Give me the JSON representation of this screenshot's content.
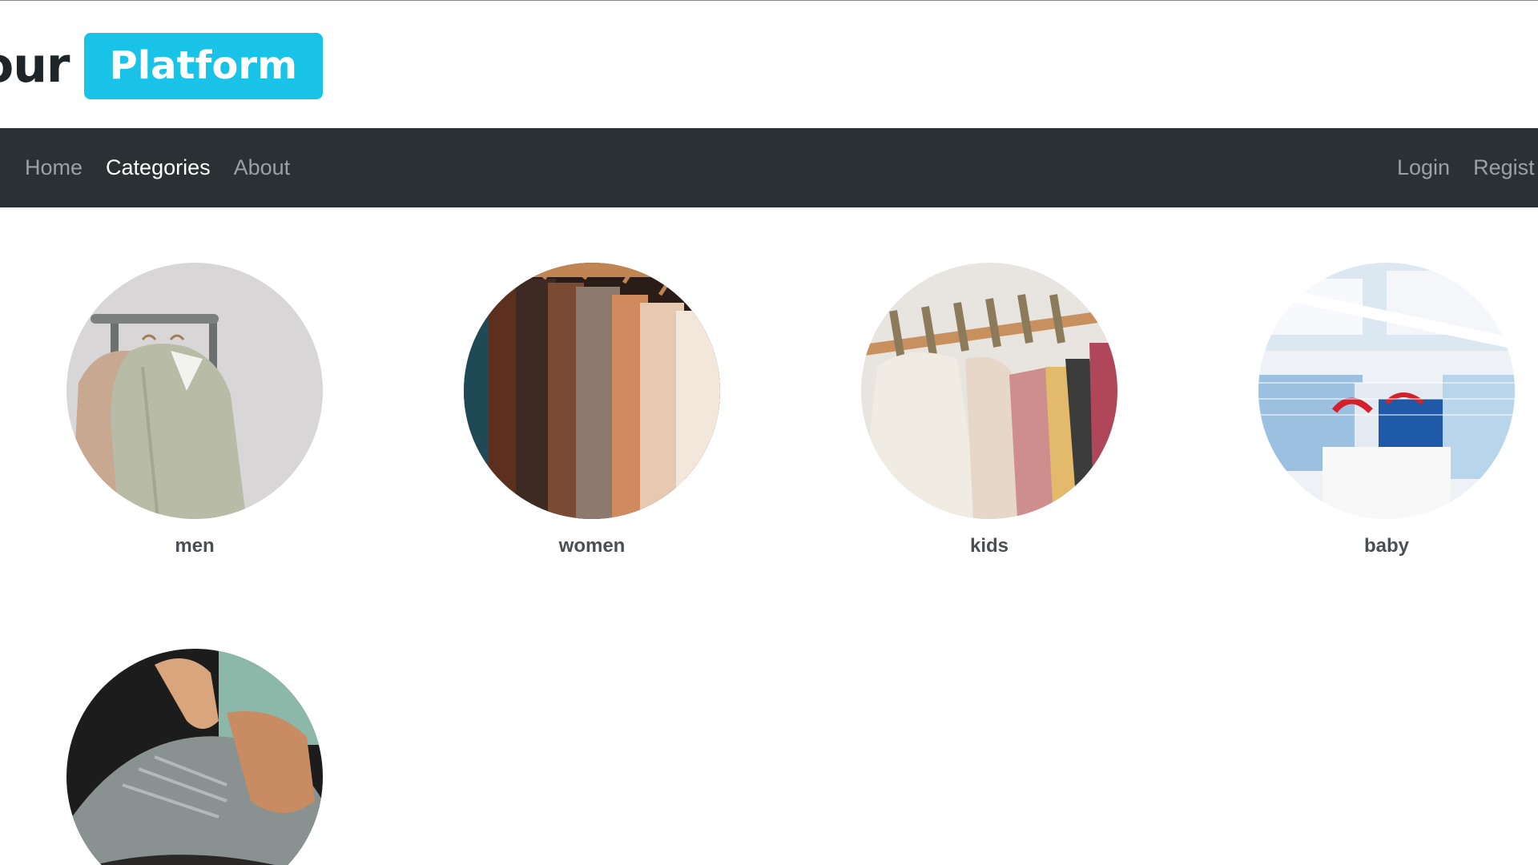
{
  "header": {
    "brand_text": "our",
    "brand_badge": "Platform",
    "accent_color": "#18c3e7"
  },
  "navbar": {
    "left_links": [
      {
        "label": "Home",
        "active": false
      },
      {
        "label": "Categories",
        "active": true
      },
      {
        "label": "About",
        "active": false
      }
    ],
    "right_links": [
      {
        "label": "Login"
      },
      {
        "label": "Regist"
      }
    ],
    "background": "#2b3035"
  },
  "categories": [
    {
      "label": "men",
      "image": "coat-on-rack-photo"
    },
    {
      "label": "women",
      "image": "clothes-on-hangers-photo"
    },
    {
      "label": "kids",
      "image": "kids-jackets-on-rail-photo"
    },
    {
      "label": "baby",
      "image": "folded-baby-clothes-photo"
    },
    {
      "label": "",
      "image": "tying-sneaker-photo"
    }
  ]
}
